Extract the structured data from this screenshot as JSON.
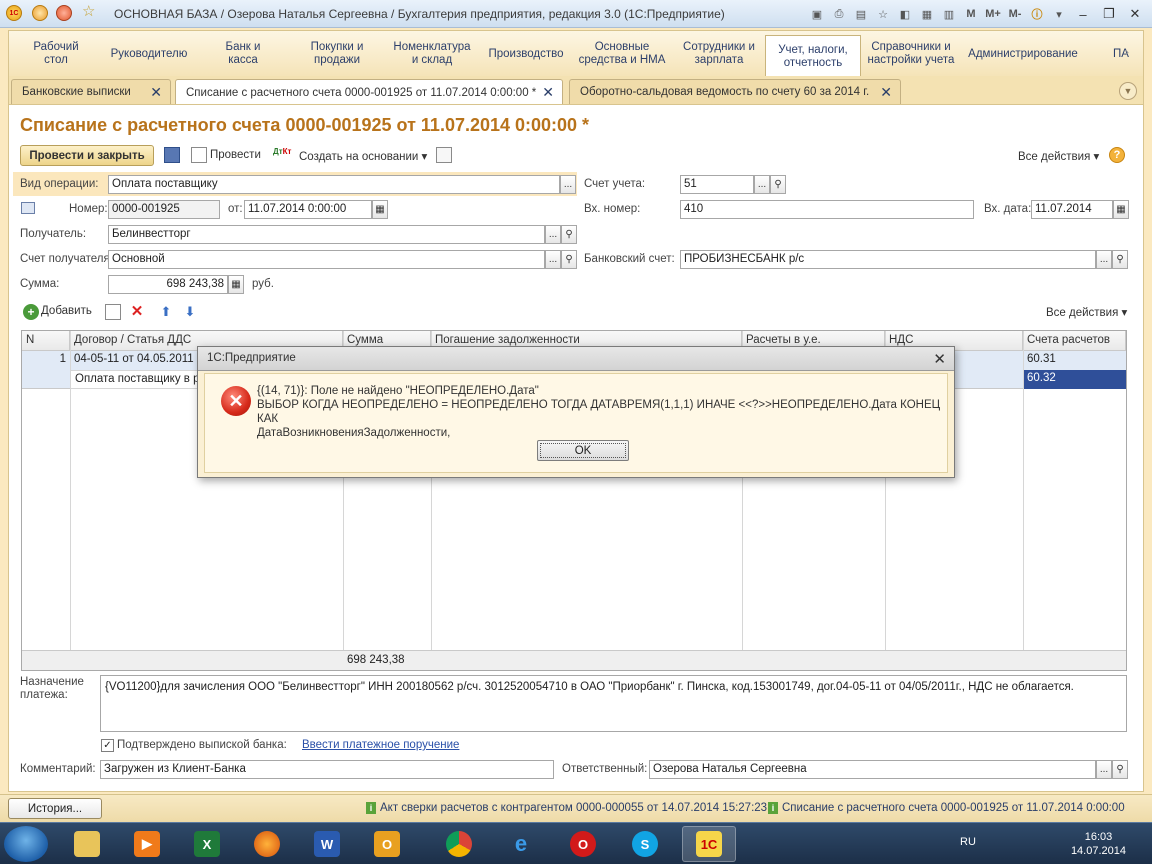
{
  "window": {
    "title": "ОСНОВНАЯ БАЗА / Озерова Наталья Сергеевна / Бухгалтерия предприятия, редакция 3.0  (1С:Предприятие)",
    "tb_m": "M",
    "tb_mplus": "M+",
    "tb_mminus": "M-"
  },
  "sections": [
    {
      "label": "Рабочий стол"
    },
    {
      "label": "Руководителю"
    },
    {
      "label": "Банк и касса"
    },
    {
      "label": "Покупки и продажи"
    },
    {
      "label": "Номенклатура и склад"
    },
    {
      "label": "Производство"
    },
    {
      "label": "Основные средства и НМА"
    },
    {
      "label": "Сотрудники и зарплата"
    },
    {
      "label": "Учет, налоги, отчетность"
    },
    {
      "label": "Справочники и настройки учета"
    },
    {
      "label": "Администрирование"
    },
    {
      "label": "ПА"
    }
  ],
  "tabs": [
    {
      "label": "Банковские выписки"
    },
    {
      "label": "Списание с расчетного счета 0000-001925 от 11.07.2014 0:00:00 *"
    },
    {
      "label": "Оборотно-сальдовая ведомость по счету 60 за 2014 г."
    }
  ],
  "doc": {
    "title": "Списание с расчетного счета 0000-001925 от 11.07.2014 0:00:00 *",
    "toolbar": {
      "post_close": "Провести и закрыть",
      "post": "Провести",
      "create_based": "Создать на основании",
      "all_actions": "Все действия"
    },
    "fields": {
      "op_type_label": "Вид операции:",
      "op_type": "Оплата поставщику",
      "account_label": "Счет учета:",
      "account": "51",
      "number_label": "Номер:",
      "number": "0000-001925",
      "from_label": "от:",
      "date": "11.07.2014  0:00:00",
      "in_number_label": "Вх. номер:",
      "in_number": "410",
      "in_date_label": "Вх. дата:",
      "in_date": "11.07.2014",
      "recipient_label": "Получатель:",
      "recipient": "Белинвестторг",
      "recipient_account_label": "Счет получателя:",
      "recipient_account": "Основной",
      "bank_account_label": "Банковский счет:",
      "bank_account": "ПРОБИЗНЕСБАНК р/с",
      "sum_label": "Сумма:",
      "sum": "698 243,38",
      "currency": "руб."
    },
    "table_toolbar": {
      "add": "Добавить",
      "all_actions": "Все действия"
    },
    "table": {
      "columns": [
        "N",
        "Договор / Статья ДДС",
        "Сумма",
        "Погашение задолженности",
        "Расчеты в у.е.",
        "НДС",
        "Счета расчетов"
      ],
      "rows": [
        {
          "n": "1",
          "contract": "04-05-11 от 04.05.2011",
          "dds": "Оплата поставщику в ру",
          "account1": "60.31",
          "account2": "60.32"
        }
      ],
      "total": "698 243,38"
    },
    "purpose_label": "Назначение платежа:",
    "purpose": "{VO11200}для зачисления ООО \"Белинвестторг\" ИНН 200180562 р/сч. 3012520054710 в ОАО \"Приорбанк\" г. Пинска, код.153001749, дог.04-05-11 от 04/05/2011г., НДС не облагается.",
    "confirmed_label": "Подтверждено выпиской банка:",
    "enter_order_link": "Ввести платежное поручение",
    "comment_label": "Комментарий:",
    "comment": "Загружен из Клиент-Банка",
    "responsible_label": "Ответственный:",
    "responsible": "Озерова Наталья Сергеевна"
  },
  "dialog": {
    "title": "1С:Предприятие",
    "message_line1": "{(14, 71)}: Поле не найдено \"НЕОПРЕДЕЛЕНО.Дата\"",
    "message_line2": "ВЫБОР КОГДА НЕОПРЕДЕЛЕНО = НЕОПРЕДЕЛЕНО ТОГДА ДАТАВРЕМЯ(1,1,1) ИНАЧЕ <<?>>НЕОПРЕДЕЛЕНО.Дата КОНЕЦ КАК",
    "message_line3": "ДатаВозникновенияЗадолженности,",
    "ok": "OK"
  },
  "statusbar": {
    "history": "История...",
    "msg1": "Акт сверки расчетов с контрагентом 0000-000055 от 14.07.2014 15:27:23",
    "msg2": "Списание с расчетного счета 0000-001925 от 11.07.2014 0:00:00"
  },
  "taskbar": {
    "lang": "RU",
    "time": "16:03",
    "date": "14.07.2014"
  },
  "colors": {
    "title_accent": "#b8731b",
    "panel_bg": "#fbe9c0",
    "selection": "#2f4f99"
  }
}
